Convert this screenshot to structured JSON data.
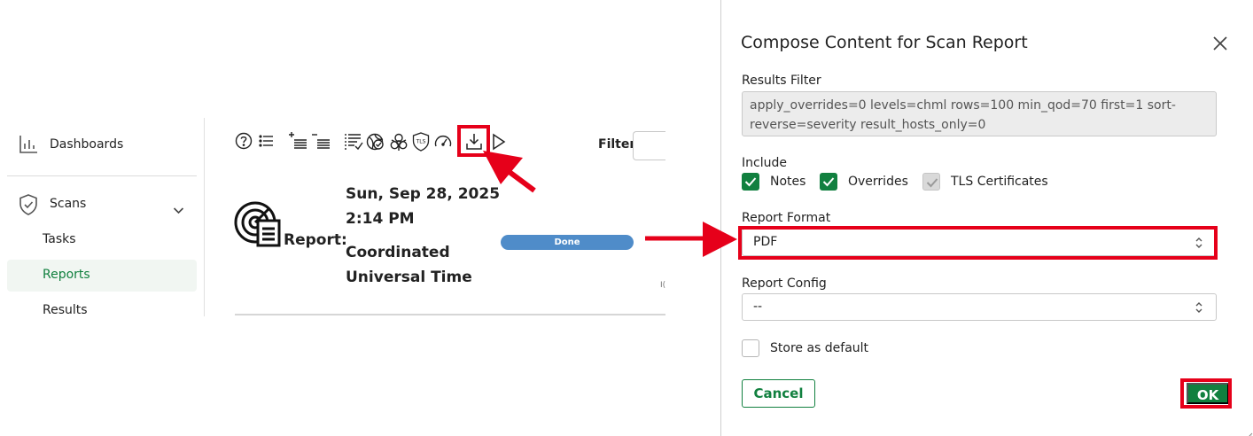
{
  "sidebar": {
    "items": [
      {
        "label": "Dashboards",
        "icon": "bar-chart-icon"
      },
      {
        "label": "Scans",
        "icon": "shield-icon"
      },
      {
        "label": "Tasks"
      },
      {
        "label": "Reports",
        "active": true
      },
      {
        "label": "Results"
      }
    ],
    "active_color": "#11803f"
  },
  "toolbar": {
    "icons": [
      "help-icon",
      "list-icon",
      "add-list-icon",
      "remove-list-icon",
      "checklist-icon",
      "os-scan-icon",
      "biohazard-icon",
      "tls-icon",
      "speedometer-icon",
      "download-icon",
      "play-icon"
    ],
    "filter_label": "Filter"
  },
  "report": {
    "label": "Report:",
    "date_line1": "Sun, Sep 28, 2025",
    "date_line2": "2:14 PM",
    "tz_line1": "Coordinated",
    "tz_line2": "Universal Time",
    "status": "Done",
    "status_color": "#4f8cc9",
    "id_fragment": "I("
  },
  "dialog": {
    "title": "Compose Content for Scan Report",
    "results_filter_label": "Results Filter",
    "results_filter_value": "apply_overrides=0 levels=chml rows=100 min_qod=70 first=1 sort-reverse=severity result_hosts_only=0",
    "include_label": "Include",
    "include_options": [
      {
        "label": "Notes",
        "checked": true,
        "disabled": false
      },
      {
        "label": "Overrides",
        "checked": true,
        "disabled": false
      },
      {
        "label": "TLS Certificates",
        "checked": true,
        "disabled": true
      }
    ],
    "report_format_label": "Report Format",
    "report_format_value": "PDF",
    "report_config_label": "Report Config",
    "report_config_value": "--",
    "store_default_label": "Store as default",
    "store_default_checked": false,
    "cancel_label": "Cancel",
    "ok_label": "OK",
    "accent_color": "#11803f"
  },
  "annotations": {
    "highlight_color": "#e6001a"
  }
}
